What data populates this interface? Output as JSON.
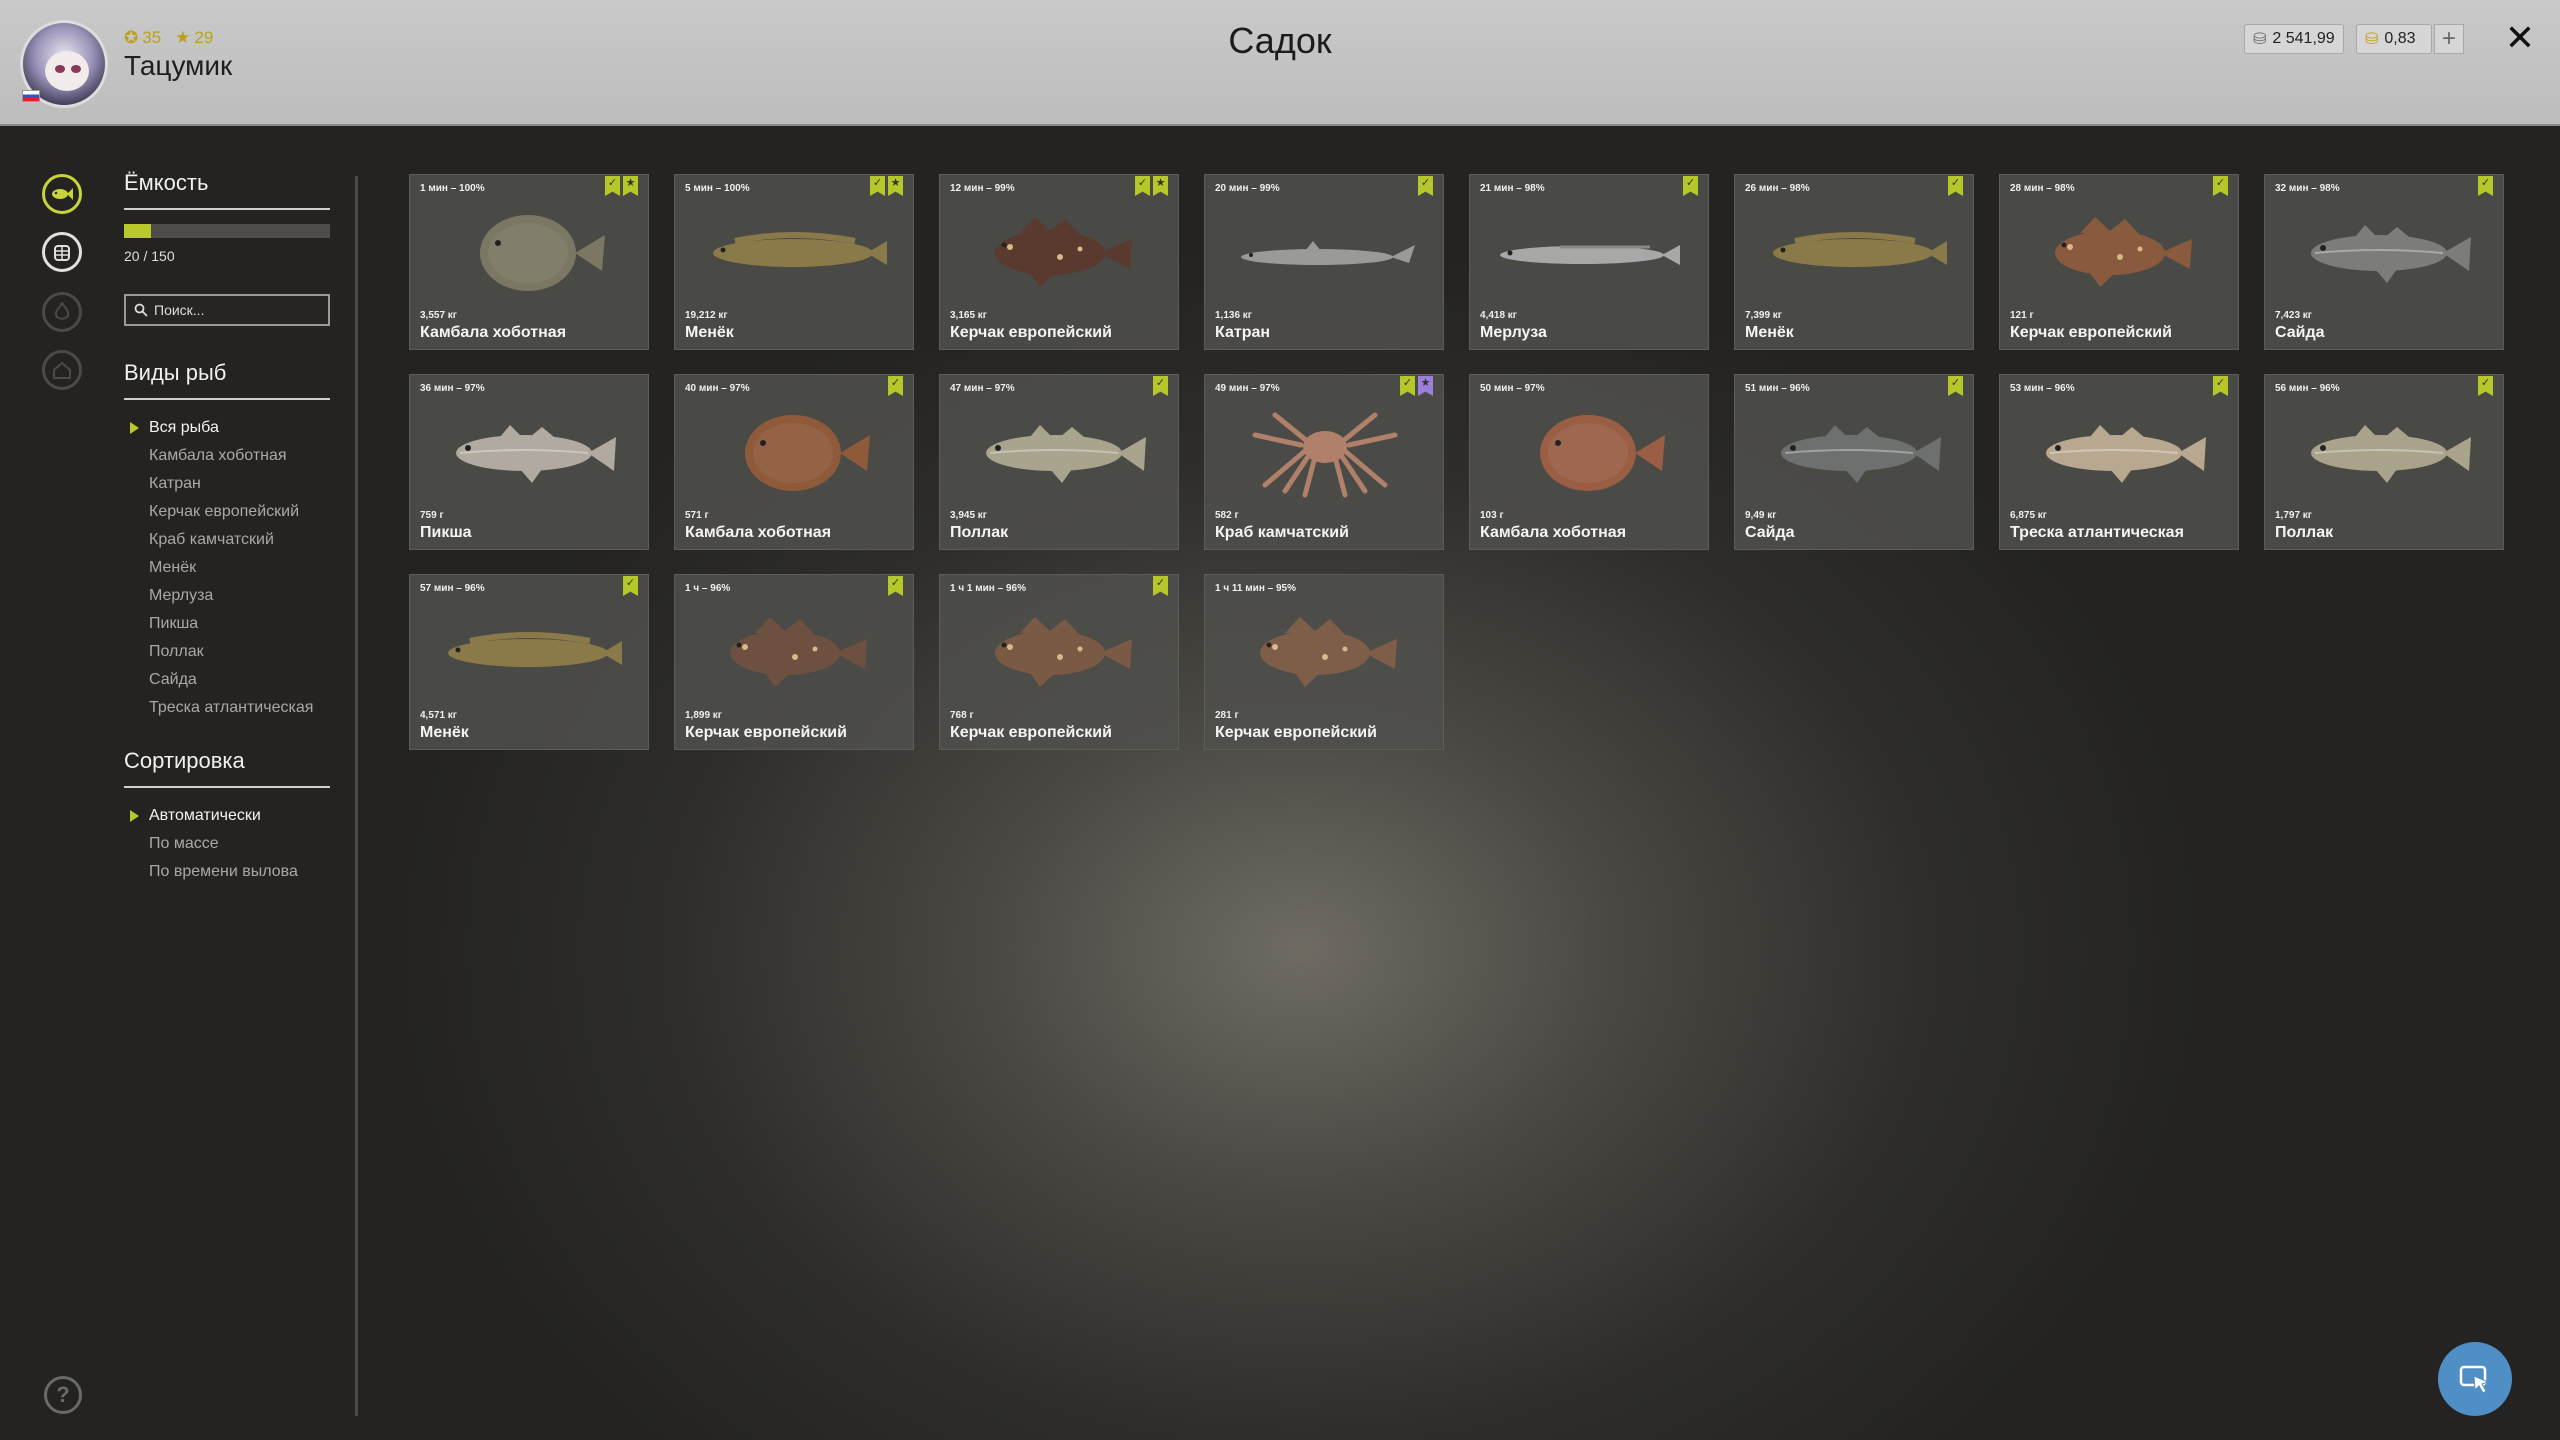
{
  "header": {
    "title": "Садок",
    "player_name": "Тацумик",
    "level": "35",
    "rank": "29",
    "silver": "2 541,99",
    "gold": "0,83",
    "plus_label": "+",
    "close_label": "✕"
  },
  "sidebar": {
    "capacity_title": "Ёмкость",
    "capacity_text": "20 / 150",
    "capacity_fraction": 0.1333,
    "search_placeholder": "Поиск...",
    "species_title": "Виды рыб",
    "species": [
      {
        "label": "Вся рыба",
        "active": true
      },
      {
        "label": "Камбала хоботная",
        "active": false
      },
      {
        "label": "Катран",
        "active": false
      },
      {
        "label": "Керчак европейский",
        "active": false
      },
      {
        "label": "Краб камчатский",
        "active": false
      },
      {
        "label": "Менёк",
        "active": false
      },
      {
        "label": "Мерлуза",
        "active": false
      },
      {
        "label": "Пикша",
        "active": false
      },
      {
        "label": "Поллак",
        "active": false
      },
      {
        "label": "Сайда",
        "active": false
      },
      {
        "label": "Треска атлантическая",
        "active": false
      }
    ],
    "sort_title": "Сортировка",
    "sort_options": [
      {
        "label": "Автоматически",
        "active": true
      },
      {
        "label": "По массе",
        "active": false
      },
      {
        "label": "По времени вылова",
        "active": false
      }
    ]
  },
  "fish": [
    {
      "time": "1 мин – 100%",
      "weight": "3,557 кг",
      "name": "Камбала хоботная",
      "badges": [
        "check",
        "star"
      ],
      "shape": "flat",
      "color": "#7a7862"
    },
    {
      "time": "5 мин – 100%",
      "weight": "19,212 кг",
      "name": "Менёк",
      "badges": [
        "check",
        "star"
      ],
      "shape": "long",
      "color": "#8a7a4a"
    },
    {
      "time": "12 мин – 99%",
      "weight": "3,165 кг",
      "name": "Керчак европейский",
      "badges": [
        "check",
        "star"
      ],
      "shape": "sculpin",
      "color": "#5a3a2e"
    },
    {
      "time": "20 мин – 99%",
      "weight": "1,136 кг",
      "name": "Катран",
      "badges": [
        "check"
      ],
      "shape": "shark",
      "color": "#9a9a96"
    },
    {
      "time": "21 мин – 98%",
      "weight": "4,418 кг",
      "name": "Мерлуза",
      "badges": [
        "check"
      ],
      "shape": "slim",
      "color": "#a8a8a8"
    },
    {
      "time": "26 мин – 98%",
      "weight": "7,399 кг",
      "name": "Менёк",
      "badges": [
        "check"
      ],
      "shape": "long",
      "color": "#8a7a4a"
    },
    {
      "time": "28 мин – 98%",
      "weight": "121 г",
      "name": "Керчак европейский",
      "badges": [
        "check"
      ],
      "shape": "sculpin",
      "color": "#8a5a3e"
    },
    {
      "time": "32 мин – 98%",
      "weight": "7,423 кг",
      "name": "Сайда",
      "badges": [
        "check"
      ],
      "shape": "cod",
      "color": "#7c7c78"
    },
    {
      "time": "36 мин – 97%",
      "weight": "759 г",
      "name": "Пикша",
      "badges": [],
      "shape": "cod",
      "color": "#b0aaa0"
    },
    {
      "time": "40 мин – 97%",
      "weight": "571 г",
      "name": "Камбала хоботная",
      "badges": [
        "check"
      ],
      "shape": "flat",
      "color": "#8e5a3a"
    },
    {
      "time": "47 мин – 97%",
      "weight": "3,945 кг",
      "name": "Поллак",
      "badges": [
        "check"
      ],
      "shape": "cod",
      "color": "#a8a48e"
    },
    {
      "time": "49 мин – 97%",
      "weight": "582 г",
      "name": "Краб камчатский",
      "badges": [
        "check",
        "special"
      ],
      "shape": "crab",
      "color": "#b0806a"
    },
    {
      "time": "50 мин – 97%",
      "weight": "103 г",
      "name": "Камбала хоботная",
      "badges": [],
      "shape": "flat",
      "color": "#9a5e44"
    },
    {
      "time": "51 мин – 96%",
      "weight": "9,49 кг",
      "name": "Сайда",
      "badges": [
        "check"
      ],
      "shape": "cod",
      "color": "#6e7070"
    },
    {
      "time": "53 мин – 96%",
      "weight": "6,875 кг",
      "name": "Треска атлантическая",
      "badges": [
        "check"
      ],
      "shape": "cod",
      "color": "#b8a890"
    },
    {
      "time": "56 мин – 96%",
      "weight": "1,797 кг",
      "name": "Поллак",
      "badges": [
        "check"
      ],
      "shape": "cod",
      "color": "#aaa38c"
    },
    {
      "time": "57 мин – 96%",
      "weight": "4,571 кг",
      "name": "Менёк",
      "badges": [
        "check"
      ],
      "shape": "long",
      "color": "#8a7a4a"
    },
    {
      "time": "1 ч – 96%",
      "weight": "1,899 кг",
      "name": "Керчак европейский",
      "badges": [
        "check"
      ],
      "shape": "sculpin",
      "color": "#6e5040"
    },
    {
      "time": "1 ч 1 мин – 96%",
      "weight": "768 г",
      "name": "Керчак европейский",
      "badges": [
        "check"
      ],
      "shape": "sculpin",
      "color": "#7a5a44"
    },
    {
      "time": "1 ч 11 мин – 95%",
      "weight": "281 г",
      "name": "Керчак европейский",
      "badges": [],
      "shape": "sculpin",
      "color": "#7e5e48"
    }
  ],
  "colors": {
    "accent": "#b9c92c",
    "special_badge": "#9b7fd9",
    "card_bg": "#4e4e4b",
    "topbar_bg": "#c4c4c4"
  },
  "icons": {
    "nav": [
      "fish-icon",
      "keepnet-icon",
      "fire-icon",
      "home-icon"
    ],
    "help": "help-icon",
    "search": "search-icon",
    "close": "close-icon",
    "cursor": "cursor-icon"
  }
}
